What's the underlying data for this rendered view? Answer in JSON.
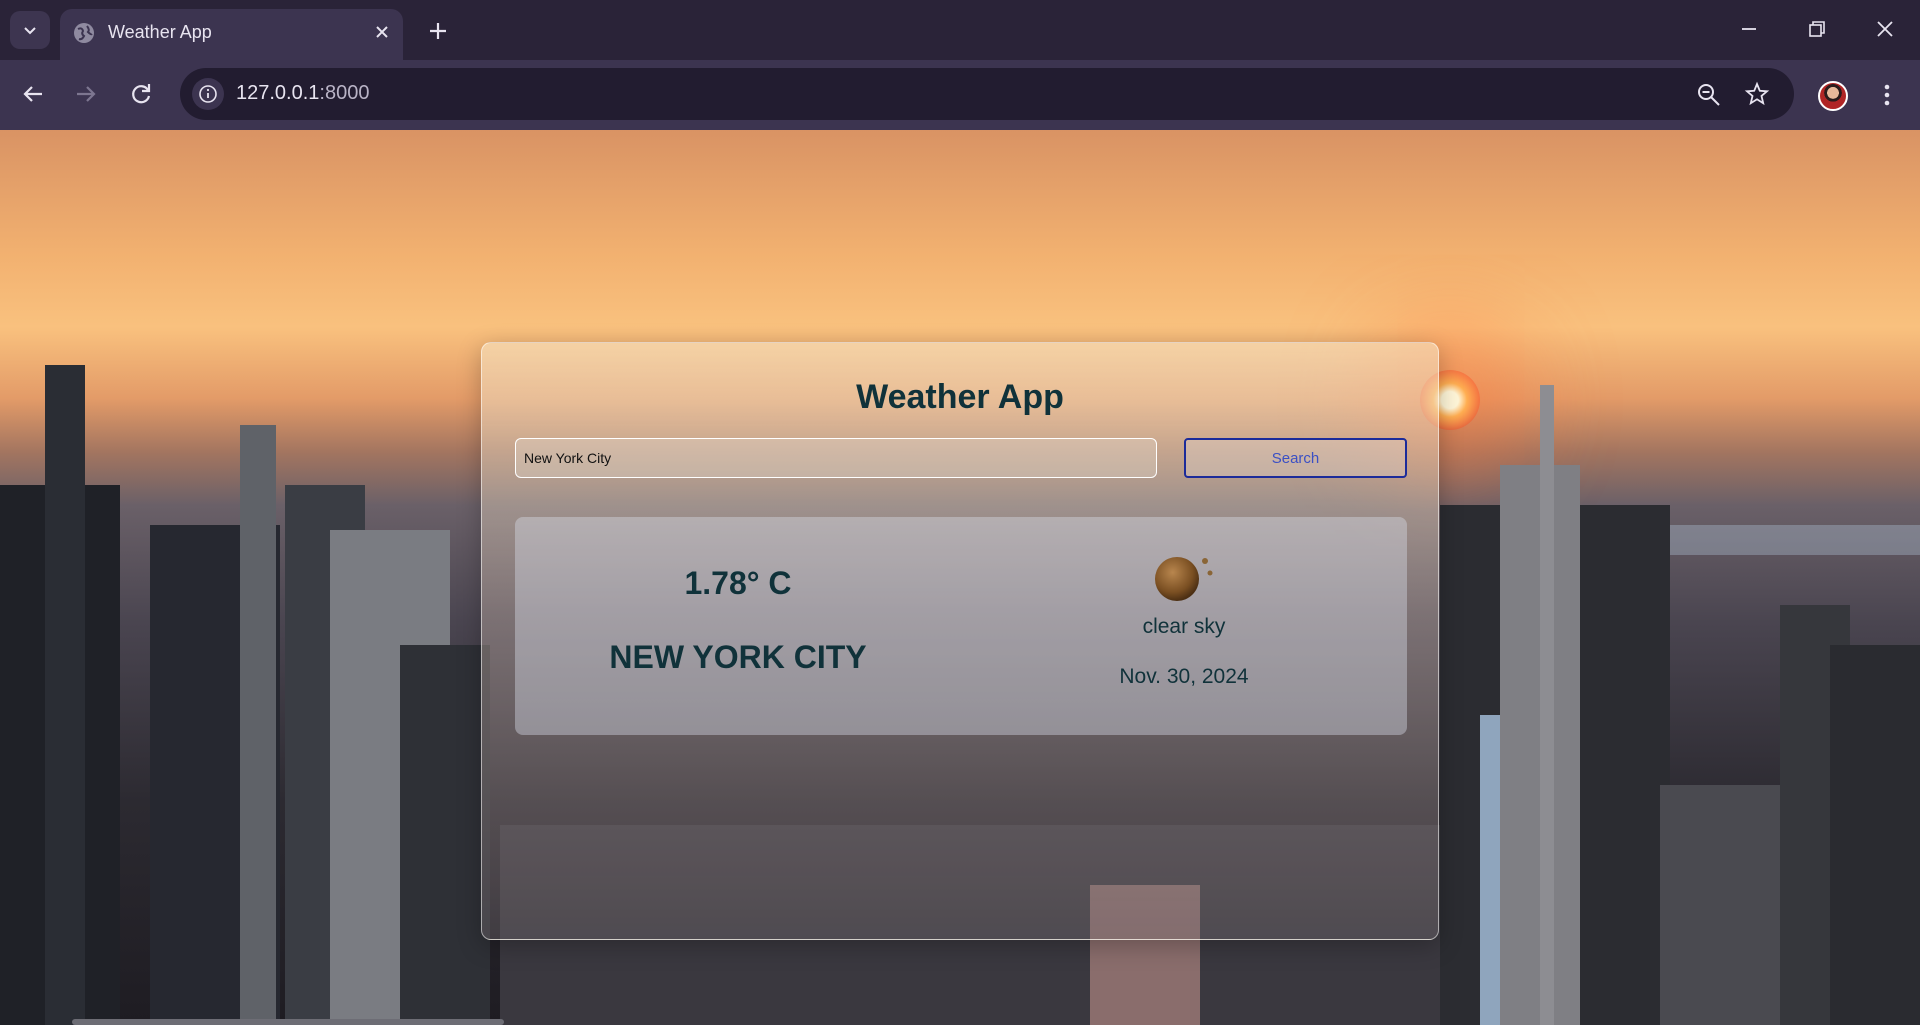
{
  "browser": {
    "tab_title": "Weather App",
    "url_host": "127.0.0.1",
    "url_port": ":8000"
  },
  "app": {
    "title": "Weather App",
    "search": {
      "value": "New York City",
      "placeholder": "",
      "button_label": "Search"
    },
    "result": {
      "temperature": "1.78° C",
      "city": "NEW YORK CITY",
      "description": "clear sky",
      "date": "Nov. 30, 2024",
      "icon": "clear-sky-icon"
    }
  },
  "colors": {
    "title_text": "#10323a",
    "button_border": "#1b2b9a",
    "button_text": "#3b50c4"
  }
}
